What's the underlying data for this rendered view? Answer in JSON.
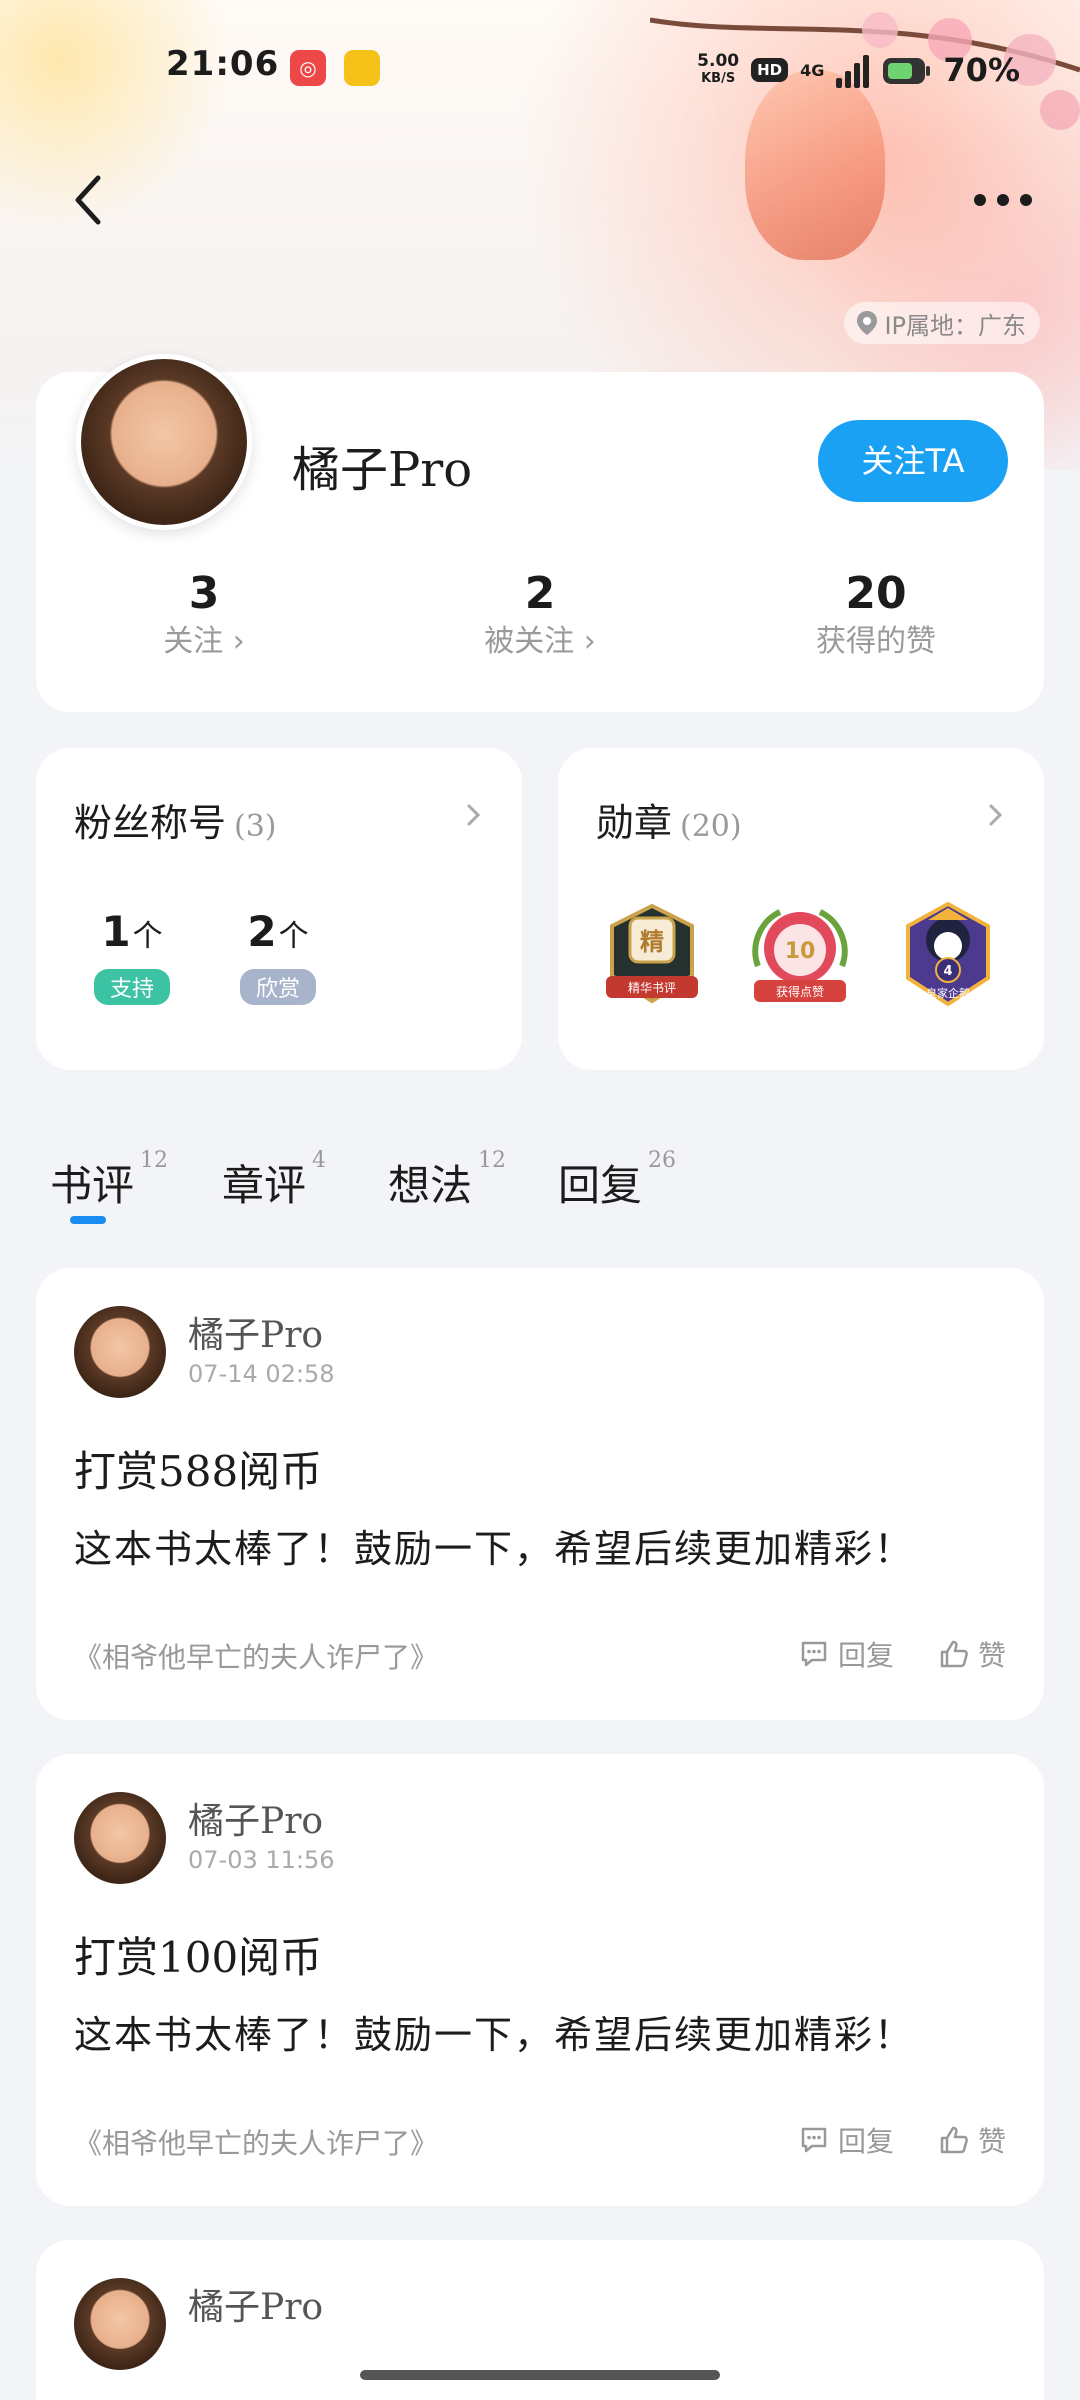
{
  "status_bar": {
    "time": "21:06",
    "app_icon_1": "app-notification-icon",
    "app_icon_2": "app-notification-icon",
    "net_speed_value": "5.00",
    "net_speed_unit": "KB/S",
    "hd_label": "HD",
    "network_type": "4G",
    "battery": "70%"
  },
  "header": {
    "back_icon": "back-arrow-icon",
    "more_icon": "more-dots-icon",
    "ip_location": "IP属地：广东"
  },
  "profile": {
    "username": "橘子Pro",
    "follow_button": "关注TA",
    "stats": [
      {
        "value": "3",
        "label": "关注 ›"
      },
      {
        "value": "2",
        "label": "被关注 ›"
      },
      {
        "value": "20",
        "label": "获得的赞"
      }
    ]
  },
  "fans_card": {
    "title": "粉丝称号",
    "count": "(3)",
    "items": [
      {
        "value": "1",
        "unit": "个",
        "badge": "支持",
        "badge_color": "#3cc3a4"
      },
      {
        "value": "2",
        "unit": "个",
        "badge": "欣赏",
        "badge_color": "#a8b3cc"
      }
    ]
  },
  "medals_card": {
    "title": "勋章",
    "count": "(20)",
    "medals": [
      {
        "icon": "best-review-medal-icon",
        "label": "精华书评",
        "mark": "精"
      },
      {
        "icon": "likes-medal-icon",
        "label": "获得点赞",
        "mark": "10"
      },
      {
        "icon": "royal-penguin-medal-icon",
        "label": "皇家企鹅",
        "mark": "4"
      }
    ]
  },
  "tabs": [
    {
      "label": "书评",
      "count": "12"
    },
    {
      "label": "章评",
      "count": "4"
    },
    {
      "label": "想法",
      "count": "12"
    },
    {
      "label": "回复",
      "count": "26"
    }
  ],
  "active_tab_color": "#1a8cf2",
  "posts": [
    {
      "author": "橘子Pro",
      "time": "07-14 02:58",
      "title": "打赏588阅币",
      "body": "这本书太棒了！鼓励一下，希望后续更加精彩！",
      "book": "《相爷他早亡的夫人诈尸了》",
      "reply_label": "回复",
      "like_label": "赞"
    },
    {
      "author": "橘子Pro",
      "time": "07-03 11:56",
      "title": "打赏100阅币",
      "body": "这本书太棒了！鼓励一下，希望后续更加精彩！",
      "book": "《相爷他早亡的夫人诈尸了》",
      "reply_label": "回复",
      "like_label": "赞"
    },
    {
      "author": "橘子Pro"
    }
  ]
}
